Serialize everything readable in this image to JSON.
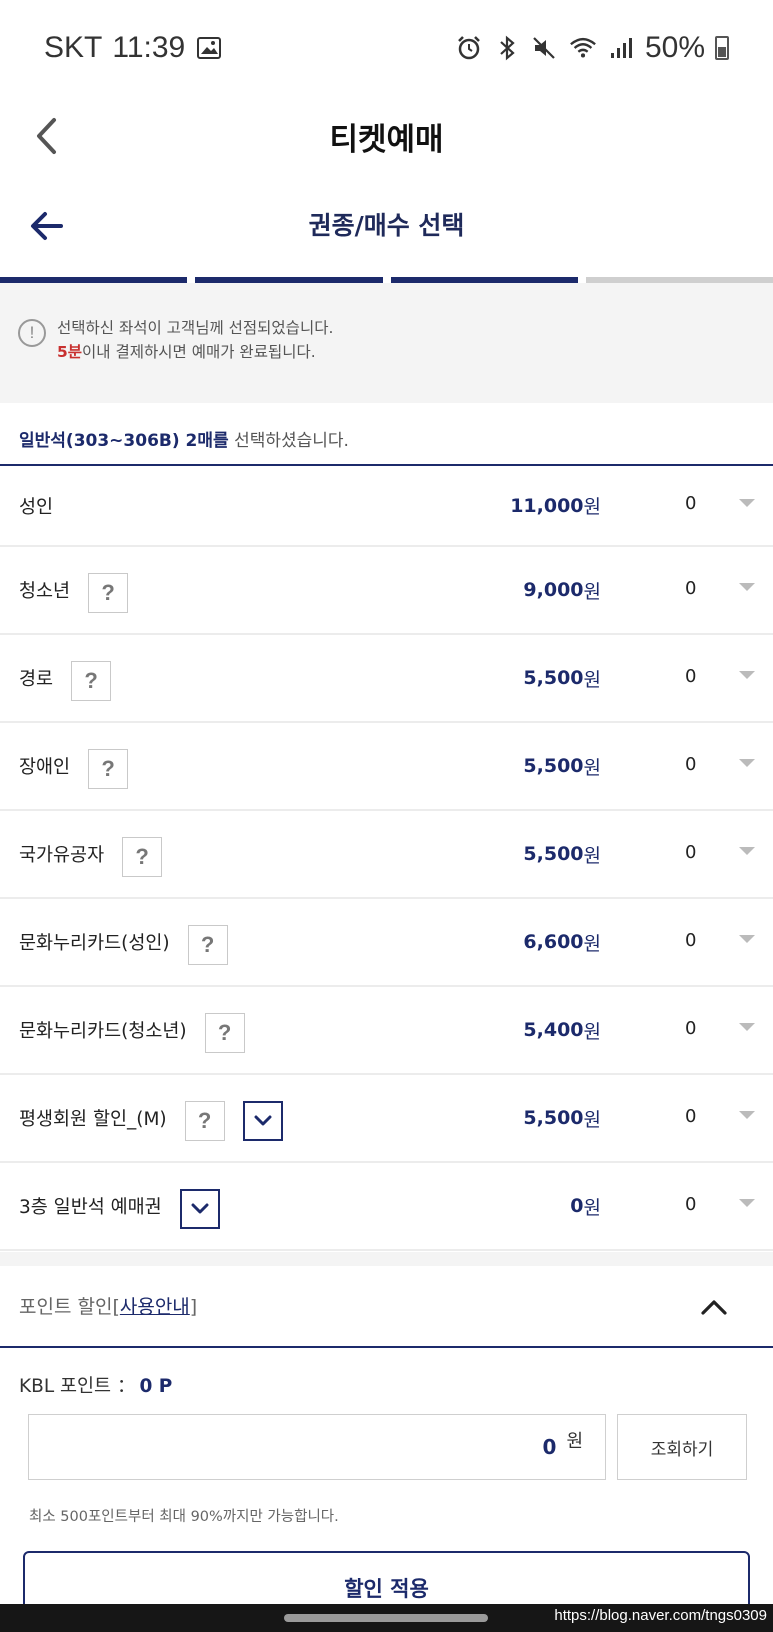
{
  "status_bar": {
    "carrier": "SKT",
    "time": "11:39",
    "battery": "50%",
    "icons": [
      "gallery-icon",
      "alarm-icon",
      "bluetooth-icon",
      "mute-icon",
      "wifi-icon",
      "signal-icon",
      "battery-icon"
    ]
  },
  "header": {
    "title": "티켓예매"
  },
  "step": {
    "title": "권종/매수 선택",
    "total_steps": 4,
    "current_step": 3
  },
  "notice": {
    "line1": "선택하신 좌석이 고객님께 선점되었습니다.",
    "time_highlight": "5분",
    "line2_rest": "이내 결제하시면 예매가 완료됩니다."
  },
  "selection": {
    "seat_info": "일반석(303~306B) 2매를",
    "suffix": " 선택하셨습니다."
  },
  "tickets": [
    {
      "name": "성인",
      "price": "11,000",
      "unit": "원",
      "qty": "0",
      "help": false,
      "expand": false
    },
    {
      "name": "청소년",
      "price": "9,000",
      "unit": "원",
      "qty": "0",
      "help": true,
      "expand": false
    },
    {
      "name": "경로",
      "price": "5,500",
      "unit": "원",
      "qty": "0",
      "help": true,
      "expand": false
    },
    {
      "name": "장애인",
      "price": "5,500",
      "unit": "원",
      "qty": "0",
      "help": true,
      "expand": false
    },
    {
      "name": "국가유공자",
      "price": "5,500",
      "unit": "원",
      "qty": "0",
      "help": true,
      "expand": false
    },
    {
      "name": "문화누리카드(성인)",
      "price": "6,600",
      "unit": "원",
      "qty": "0",
      "help": true,
      "expand": false
    },
    {
      "name": "문화누리카드(청소년)",
      "price": "5,400",
      "unit": "원",
      "qty": "0",
      "help": true,
      "expand": false
    },
    {
      "name": "평생회원 할인_(M)",
      "price": "5,500",
      "unit": "원",
      "qty": "0",
      "help": true,
      "expand": true
    },
    {
      "name": "3층 일반석 예매권",
      "price": "0",
      "unit": "원",
      "qty": "0",
      "help": false,
      "expand": true
    }
  ],
  "help_label": "?",
  "points": {
    "title": "포인트 할인[",
    "guide_link": "사용안내",
    "title_end": "]",
    "kbl_label": "KBL 포인트 ：",
    "kbl_value": "0 P",
    "input_value": "0",
    "input_unit": "원",
    "lookup_label": "조회하기",
    "note": "최소 500포인트부터 최대 90%까지만 가능합니다.",
    "apply_label": "할인 적용"
  },
  "watermark": "https://blog.naver.com/tngs0309",
  "colors": {
    "navy": "#1c2a6b",
    "red": "#c8302f",
    "gray_bg": "#f4f4f4"
  }
}
